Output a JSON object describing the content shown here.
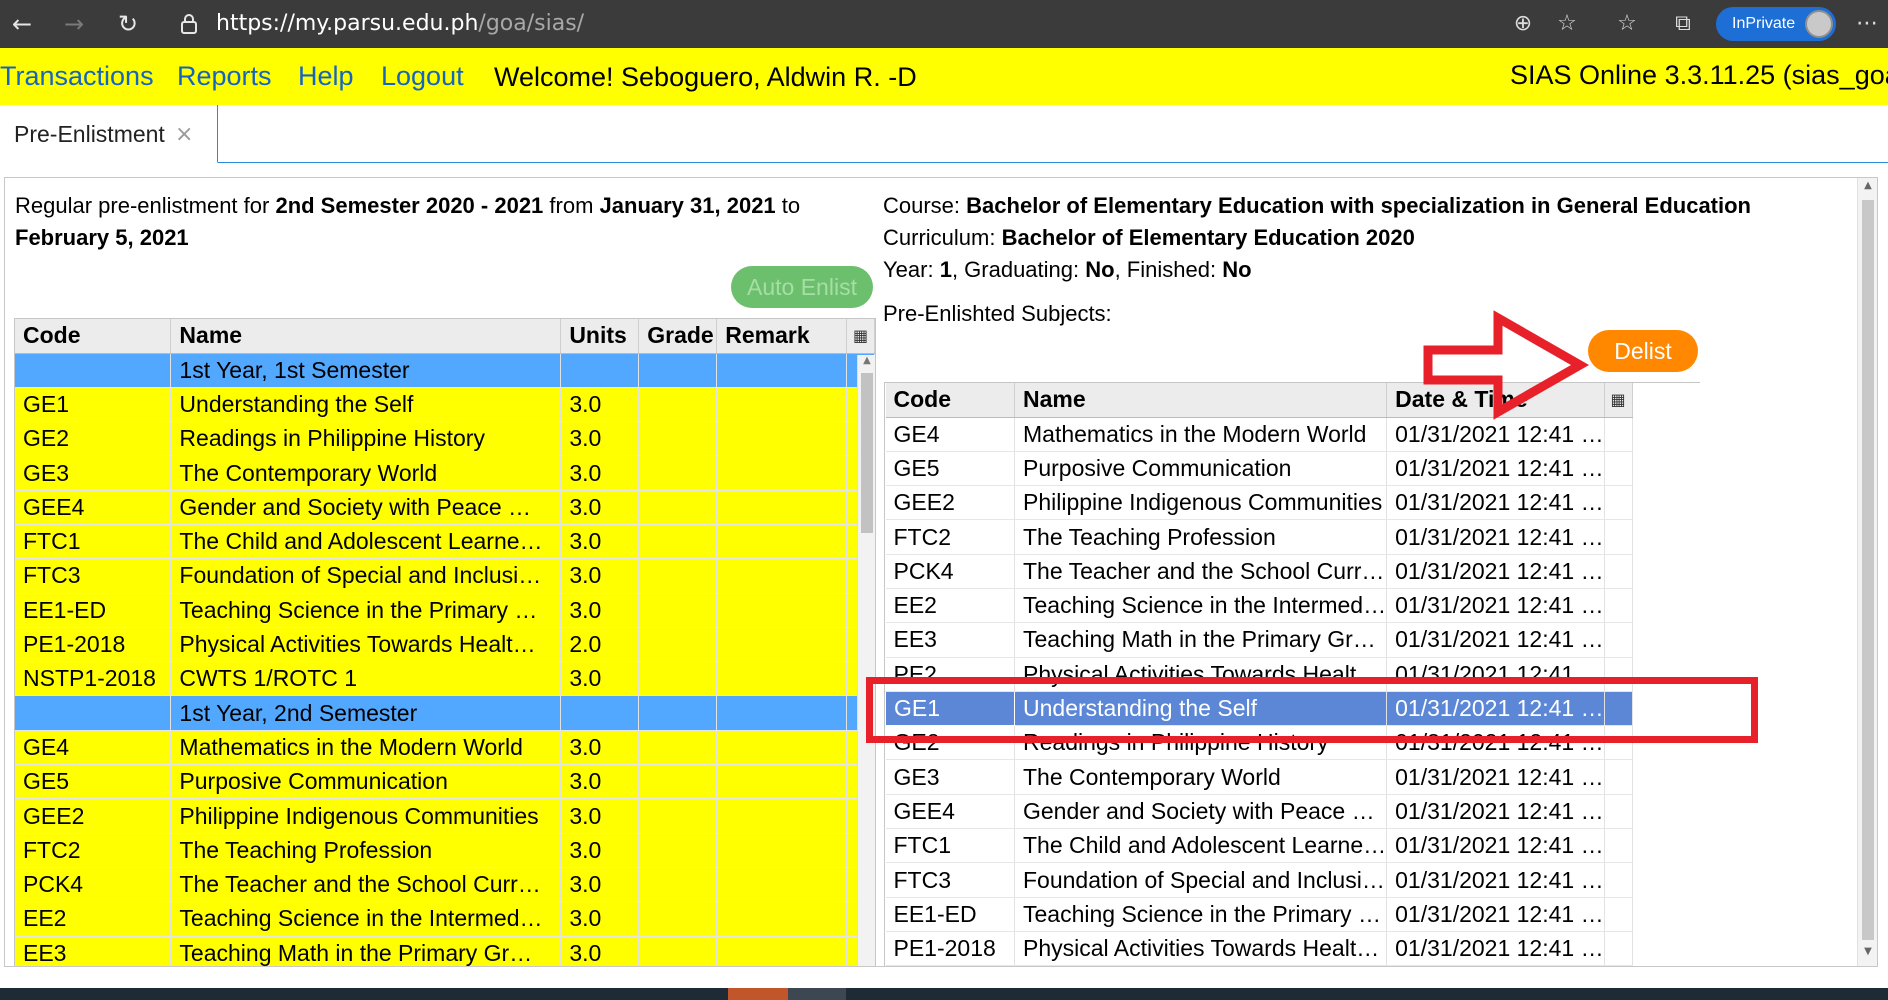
{
  "browser": {
    "url_host": "https://my.parsu.edu.ph",
    "url_path": "/goa/sias/",
    "inprivate_label": "InPrivate",
    "icons": [
      "back-arrow-icon",
      "forward-arrow-icon",
      "refresh-icon",
      "lock-icon",
      "zoom-icon",
      "add-favorite-icon",
      "favorites-icon",
      "collections-icon",
      "more-icon"
    ]
  },
  "header": {
    "menu": [
      "Transactions",
      "Reports",
      "Help",
      "Logout"
    ],
    "welcome": "Welcome! Seboguero, Aldwin R. -D",
    "version": "SIAS Online 3.3.11.25 (sias_goa"
  },
  "tabs": [
    {
      "label": "Pre-Enlistment",
      "close": "×"
    }
  ],
  "enlistment": {
    "period_prefix": "Regular pre-enlistment for ",
    "semester": "2nd Semester 2020 - 2021",
    "from_text": " from ",
    "date_from": "January 31, 2021",
    "to_text": " to ",
    "date_to": "February 5, 2021",
    "auto_enlist_label": "Auto Enlist"
  },
  "curriculum_table": {
    "columns": [
      "Code",
      "Name",
      "Units",
      "Grade",
      "Remark"
    ],
    "rows": [
      {
        "type": "group",
        "code": "",
        "name": "1st Year, 1st Semester",
        "units": "",
        "grade": "",
        "remark": ""
      },
      {
        "type": "subj",
        "code": "GE1",
        "name": "Understanding the Self",
        "units": "3.0",
        "grade": "",
        "remark": ""
      },
      {
        "type": "subj",
        "code": "GE2",
        "name": "Readings in Philippine History",
        "units": "3.0",
        "grade": "",
        "remark": ""
      },
      {
        "type": "subj",
        "code": "GE3",
        "name": "The Contemporary World",
        "units": "3.0",
        "grade": "",
        "remark": ""
      },
      {
        "type": "subj",
        "code": "GEE4",
        "name": "Gender and Society with Peace …",
        "units": "3.0",
        "grade": "",
        "remark": ""
      },
      {
        "type": "subj",
        "code": "FTC1",
        "name": "The Child and Adolescent Learne…",
        "units": "3.0",
        "grade": "",
        "remark": ""
      },
      {
        "type": "subj",
        "code": "FTC3",
        "name": "Foundation of Special and Inclusi…",
        "units": "3.0",
        "grade": "",
        "remark": ""
      },
      {
        "type": "subj",
        "code": "EE1-ED",
        "name": "Teaching Science in the Primary …",
        "units": "3.0",
        "grade": "",
        "remark": ""
      },
      {
        "type": "subj",
        "code": "PE1-2018",
        "name": "Physical Activities Towards Healt…",
        "units": "2.0",
        "grade": "",
        "remark": ""
      },
      {
        "type": "subj",
        "code": "NSTP1-2018",
        "name": "CWTS 1/ROTC 1",
        "units": "3.0",
        "grade": "",
        "remark": ""
      },
      {
        "type": "group",
        "code": "",
        "name": "1st Year, 2nd Semester",
        "units": "",
        "grade": "",
        "remark": ""
      },
      {
        "type": "subj",
        "code": "GE4",
        "name": "Mathematics in the Modern World",
        "units": "3.0",
        "grade": "",
        "remark": ""
      },
      {
        "type": "subj",
        "code": "GE5",
        "name": "Purposive Communication",
        "units": "3.0",
        "grade": "",
        "remark": ""
      },
      {
        "type": "subj",
        "code": "GEE2",
        "name": "Philippine Indigenous Communities",
        "units": "3.0",
        "grade": "",
        "remark": ""
      },
      {
        "type": "subj",
        "code": "FTC2",
        "name": "The Teaching Profession",
        "units": "3.0",
        "grade": "",
        "remark": ""
      },
      {
        "type": "subj",
        "code": "PCK4",
        "name": "The Teacher and the School Curr…",
        "units": "3.0",
        "grade": "",
        "remark": ""
      },
      {
        "type": "subj",
        "code": "EE2",
        "name": "Teaching Science in the Intermed…",
        "units": "3.0",
        "grade": "",
        "remark": ""
      },
      {
        "type": "subj",
        "code": "EE3",
        "name": "Teaching Math in the Primary Gr…",
        "units": "3.0",
        "grade": "",
        "remark": ""
      }
    ]
  },
  "student": {
    "course_label": "Course: ",
    "course": "Bachelor of Elementary Education with specialization in General Education",
    "curriculum_label": "Curriculum: ",
    "curriculum": "Bachelor of Elementary Education 2020",
    "year_label": "Year: ",
    "year": "1",
    "graduating_label": ", Graduating: ",
    "graduating": "No",
    "finished_label": ", Finished: ",
    "finished": "No"
  },
  "pre_enlisted": {
    "label": "Pre-Enlishted Subjects:",
    "delist_label": "Delist",
    "columns": [
      "Code",
      "Name",
      "Date & Time"
    ],
    "rows": [
      {
        "code": "GE4",
        "name": "Mathematics in the Modern World",
        "datetime": "01/31/2021 12:41 …"
      },
      {
        "code": "GE5",
        "name": "Purposive Communication",
        "datetime": "01/31/2021 12:41 …"
      },
      {
        "code": "GEE2",
        "name": "Philippine Indigenous Communities",
        "datetime": "01/31/2021 12:41 …"
      },
      {
        "code": "FTC2",
        "name": "The Teaching Profession",
        "datetime": "01/31/2021 12:41 …"
      },
      {
        "code": "PCK4",
        "name": "The Teacher and the School Curr…",
        "datetime": "01/31/2021 12:41 …"
      },
      {
        "code": "EE2",
        "name": "Teaching Science in the Intermed…",
        "datetime": "01/31/2021 12:41 …"
      },
      {
        "code": "EE3",
        "name": "Teaching Math in the Primary Gr…",
        "datetime": "01/31/2021 12:41 …"
      },
      {
        "code": "PE2",
        "name": "Physical Activities Towards Healt…",
        "datetime": "01/31/2021 12:41 …"
      },
      {
        "code": "GE1",
        "name": "Understanding the Self",
        "datetime": "01/31/2021 12:41 …",
        "selected": true
      },
      {
        "code": "GE2",
        "name": "Readings in Philippine History",
        "datetime": "01/31/2021 12:41 …"
      },
      {
        "code": "GE3",
        "name": "The Contemporary World",
        "datetime": "01/31/2021 12:41 …"
      },
      {
        "code": "GEE4",
        "name": "Gender and Society with Peace …",
        "datetime": "01/31/2021 12:41 …"
      },
      {
        "code": "FTC1",
        "name": "The Child and Adolescent Learne…",
        "datetime": "01/31/2021 12:41 …"
      },
      {
        "code": "FTC3",
        "name": "Foundation of Special and Inclusi…",
        "datetime": "01/31/2021 12:41 …"
      },
      {
        "code": "EE1-ED",
        "name": "Teaching Science in the Primary …",
        "datetime": "01/31/2021 12:41 …"
      },
      {
        "code": "PE1-2018",
        "name": "Physical Activities Towards Healt…",
        "datetime": "01/31/2021 12:41 …"
      }
    ]
  },
  "colors": {
    "header_bg": "#ffff00",
    "link": "#1565c0",
    "group_row": "#52a7ff",
    "subject_row": "#ffff00",
    "selected_row": "#5b87d6",
    "delist_button": "#ff8800",
    "auto_enlist_button": "#6cbf6c",
    "annotation": "#e8202a"
  }
}
